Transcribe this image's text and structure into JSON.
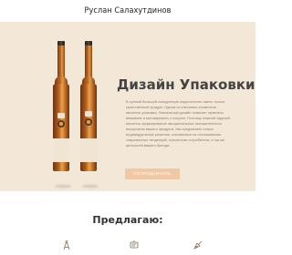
{
  "header": {
    "title": "Руслан Салахутдинов"
  },
  "hero": {
    "title": "Дизайн Упаковки",
    "paragraph": "В сунный большой конкуренции недостаточно иметь только качественный продукт. Одним из ключевых элементов является упаковка. Уникальный дизайн позволит привлечь внимание и мотивировать к покупке. Поэтому главной задачей является формирование эмоциональных положительного восприятия вашего продукта. Мы предлагаем только индивидуальные решения, основанные на отслеживании современных тенденций, психологии потребителя, а так же ценностей вашего бренда.",
    "button_label": "СОТРУДНИЧАТЬ",
    "accent_color": "#efc9a5",
    "background_color": "#f3e7d8"
  },
  "offers": {
    "title": "Предлагаю:",
    "icons": [
      "compass-icon",
      "bottle-label-icon",
      "pen-tool-icon"
    ]
  }
}
